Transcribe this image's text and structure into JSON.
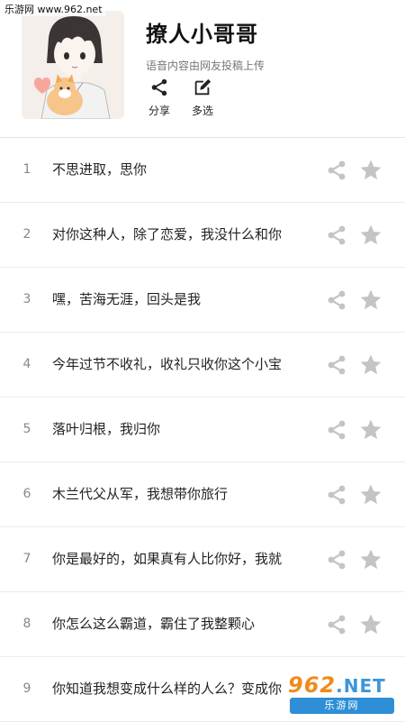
{
  "watermark": {
    "text": "乐游网 www.962.net"
  },
  "album": {
    "title": "撩人小哥哥",
    "subtitle": "语音内容由网友投稿上传"
  },
  "actions": {
    "share_label": "分享",
    "multiselect_label": "多选"
  },
  "items": [
    {
      "num": "1",
      "text": "不思进取，思你"
    },
    {
      "num": "2",
      "text": "对你这种人，除了恋爱，我没什么和你"
    },
    {
      "num": "3",
      "text": "嘿，苦海无涯，回头是我"
    },
    {
      "num": "4",
      "text": "今年过节不收礼，收礼只收你这个小宝"
    },
    {
      "num": "5",
      "text": "落叶归根，我归你"
    },
    {
      "num": "6",
      "text": "木兰代父从军，我想带你旅行"
    },
    {
      "num": "7",
      "text": "你是最好的，如果真有人比你好，我就"
    },
    {
      "num": "8",
      "text": "你怎么这么霸道，霸住了我整颗心"
    },
    {
      "num": "9",
      "text": "你知道我想变成什么样的人么？变成你"
    }
  ],
  "badge": {
    "number": "962",
    "tld": ".NET",
    "name": "乐游网"
  },
  "colors": {
    "icon_gray": "#c4c4c4",
    "badge_orange": "#f08a1c",
    "badge_blue": "#2e8fd6"
  }
}
